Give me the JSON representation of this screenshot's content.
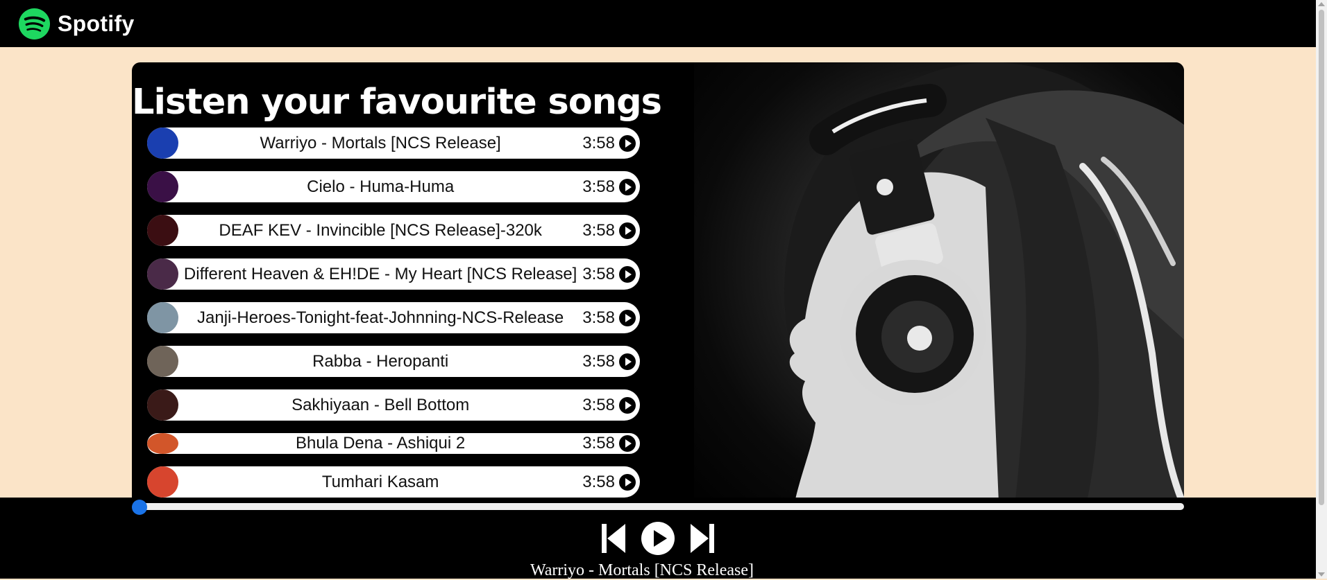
{
  "app": {
    "name": "Spotify",
    "brand_color": "#1ed760",
    "logo_icon": "spotify-logo-icon"
  },
  "main": {
    "heading": "Listen your favourite songs"
  },
  "songs": [
    {
      "name": "Warriyo - Mortals [NCS Release]",
      "duration": "3:58",
      "cover_color": "#1a3fb0"
    },
    {
      "name": "Cielo - Huma-Huma",
      "duration": "3:58",
      "cover_color": "#3a1046"
    },
    {
      "name": "DEAF KEV - Invincible [NCS Release]-320k",
      "duration": "3:58",
      "cover_color": "#3b0e12"
    },
    {
      "name": "Different Heaven & EH!DE - My Heart [NCS Release]",
      "duration": "3:58",
      "cover_color": "#4a2a48"
    },
    {
      "name": "Janji-Heroes-Tonight-feat-Johnning-NCS-Release",
      "duration": "3:58",
      "cover_color": "#7f95a4"
    },
    {
      "name": "Rabba - Heropanti",
      "duration": "3:58",
      "cover_color": "#6f6459"
    },
    {
      "name": "Sakhiyaan - Bell Bottom",
      "duration": "3:58",
      "cover_color": "#3a1a18"
    },
    {
      "name": "Bhula Dena - Ashiqui 2",
      "duration": "3:58",
      "cover_color": "#d2562a"
    },
    {
      "name": "Tumhari Kasam",
      "duration": "3:58",
      "cover_color": "#d7452e"
    }
  ],
  "player": {
    "progress_percent": 0,
    "now_playing": "Warriyo - Mortals [NCS Release]",
    "accent_color": "#1a73e8",
    "prev_icon": "skip-previous-icon",
    "play_icon": "play-circle-icon",
    "next_icon": "skip-next-icon"
  }
}
